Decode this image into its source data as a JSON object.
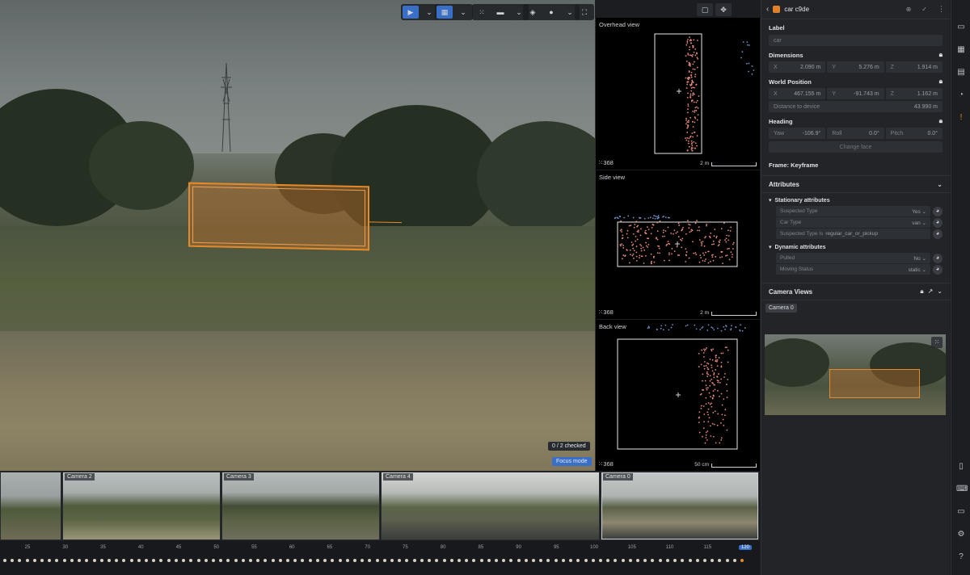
{
  "object": {
    "name": "car c9de",
    "color": "#e0802a"
  },
  "overlays": {
    "checked": "0 / 2 checked",
    "focus_mode": "Focus mode"
  },
  "views": [
    {
      "title": "Overhead view",
      "count": "368",
      "scale": "2 m"
    },
    {
      "title": "Side view",
      "count": "368",
      "scale": "2 m"
    },
    {
      "title": "Back view",
      "count": "368",
      "scale": "50 cm"
    }
  ],
  "thumbnails": [
    {
      "label": ""
    },
    {
      "label": "Camera 2"
    },
    {
      "label": "Camera 3"
    },
    {
      "label": "Camera 4"
    },
    {
      "label": "Camera 0"
    }
  ],
  "timeline": {
    "ticks": [
      "25",
      "30",
      "35",
      "40",
      "45",
      "50",
      "55",
      "60",
      "65",
      "70",
      "75",
      "80",
      "85",
      "90",
      "95",
      "100",
      "105",
      "110",
      "115",
      "120"
    ],
    "current": "120"
  },
  "panel": {
    "label_title": "Label",
    "label_value": "car",
    "dimensions_title": "Dimensions",
    "dimensions": [
      {
        "axis": "X",
        "value": "2.090 m"
      },
      {
        "axis": "Y",
        "value": "5.276 m"
      },
      {
        "axis": "Z",
        "value": "1.914 m"
      }
    ],
    "world_position_title": "World Position",
    "world_position": [
      {
        "axis": "X",
        "value": "467.155 m"
      },
      {
        "axis": "Y",
        "value": "-91.743 m"
      },
      {
        "axis": "Z",
        "value": "1.162 m"
      }
    ],
    "distance_label": "Distance to device",
    "distance_value": "43.990 m",
    "heading_title": "Heading",
    "heading": [
      {
        "axis": "Yaw",
        "value": "-106.9°"
      },
      {
        "axis": "Roll",
        "value": "0.0°"
      },
      {
        "axis": "Pitch",
        "value": "0.0°"
      }
    ],
    "change_face": "Change face",
    "frame": "Frame: Keyframe",
    "attributes_title": "Attributes",
    "stationary_title": "Stationary attributes",
    "stationary": [
      {
        "name": "Suspected Type",
        "value": "Yes"
      },
      {
        "name": "Car Type",
        "value": "van"
      },
      {
        "name": "Suspected Type Is",
        "value": "regular_car_or_pickup"
      }
    ],
    "dynamic_title": "Dynamic attributes",
    "dynamic": [
      {
        "name": "Pulled",
        "value": "No"
      },
      {
        "name": "Moving Status",
        "value": "static"
      }
    ],
    "camera_views_title": "Camera Views",
    "camera_tag": "Camera 0"
  }
}
